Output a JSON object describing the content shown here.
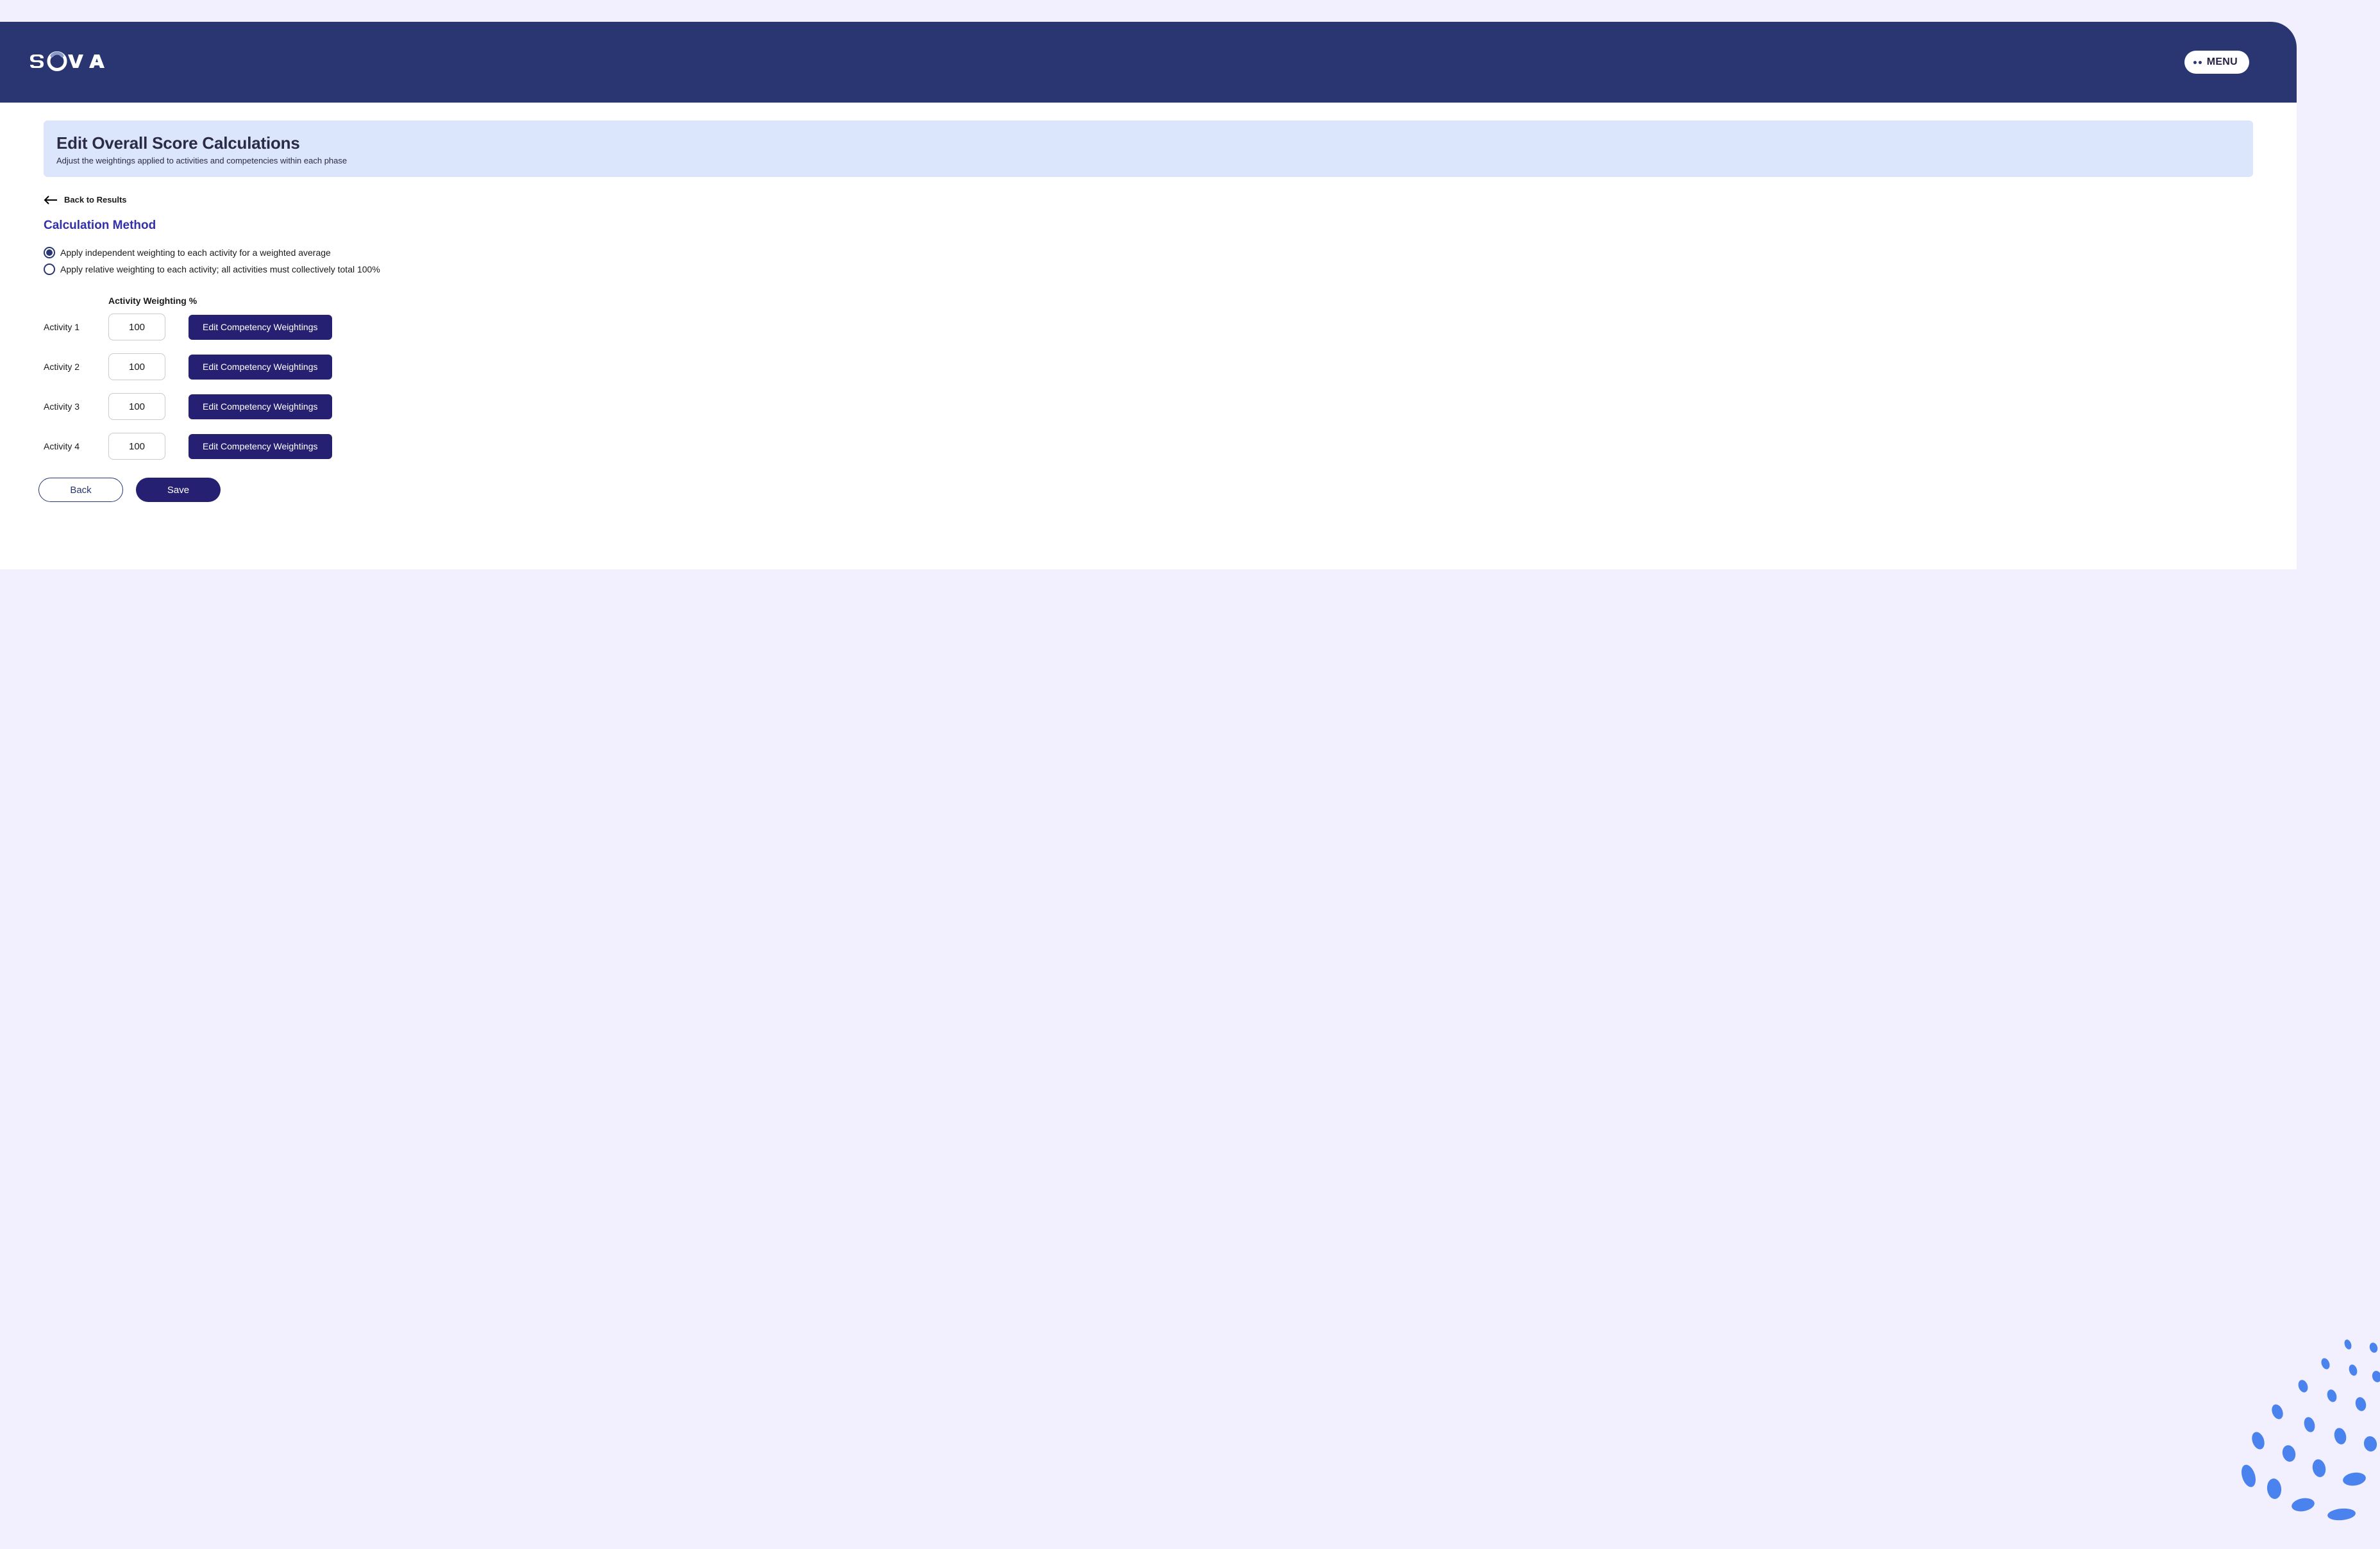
{
  "header": {
    "menu_label": "MENU"
  },
  "page": {
    "title": "Edit Overall Score Calculations",
    "subtitle": "Adjust the weightings applied to activities and competencies within each phase",
    "back_link": "Back to Results",
    "section_heading": "Calculation Method"
  },
  "calculation_method": {
    "options": [
      {
        "label": "Apply independent weighting to each activity for a weighted average",
        "selected": true
      },
      {
        "label": "Apply relative weighting to each activity; all activities must collectively total 100%",
        "selected": false
      }
    ]
  },
  "weighting": {
    "column_header": "Activity Weighting %",
    "edit_button_label": "Edit Competency Weightings",
    "activities": [
      {
        "name": "Activity 1",
        "value": "100"
      },
      {
        "name": "Activity 2",
        "value": "100"
      },
      {
        "name": "Activity 3",
        "value": "100"
      },
      {
        "name": "Activity 4",
        "value": "100"
      }
    ]
  },
  "footer": {
    "back_label": "Back",
    "save_label": "Save"
  },
  "colors": {
    "header_bg": "#293672",
    "primary_button": "#252071",
    "title_box_bg": "#dbe5fb",
    "page_bg": "#f2efff",
    "section_heading": "#3330a8",
    "accent_blue": "#4a82ee"
  }
}
